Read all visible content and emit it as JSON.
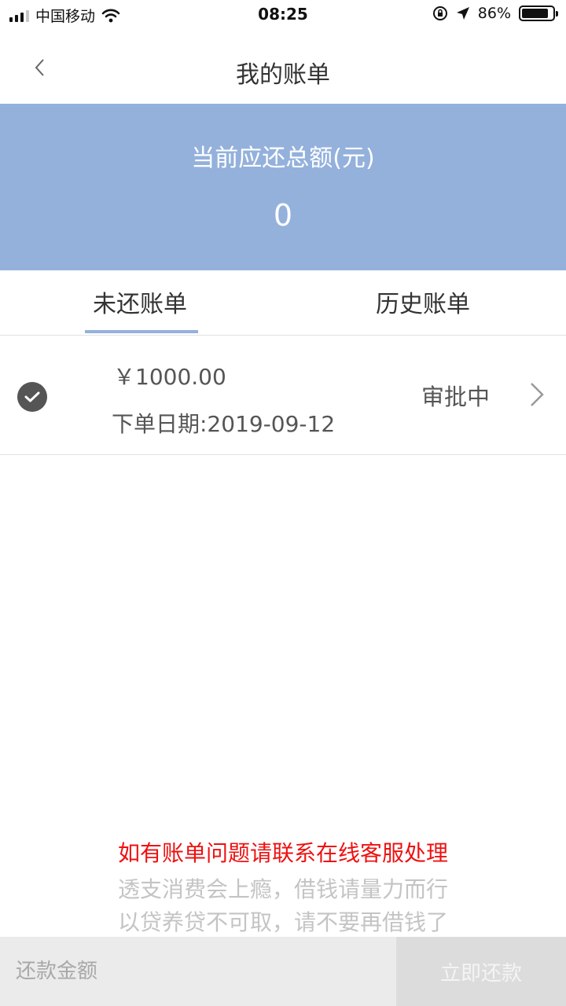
{
  "status_bar": {
    "carrier": "中国移动",
    "time": "08:25",
    "battery": "86%",
    "battery_level": 0.86,
    "icons": [
      "signal-icon",
      "wifi-icon",
      "rotation-lock-icon",
      "location-arrow-icon",
      "battery-icon"
    ]
  },
  "nav": {
    "title": "我的账单",
    "back_icon": "chevron-left-icon"
  },
  "summary": {
    "label": "当前应还总额(元)",
    "amount": "0"
  },
  "tabs": [
    {
      "label": "未还账单",
      "active": true
    },
    {
      "label": "历史账单",
      "active": false
    }
  ],
  "bills": [
    {
      "amount": "￥1000.00",
      "date": "下单日期:2019-09-12",
      "status": "审批中",
      "icon": "check-circle-icon"
    }
  ],
  "notices": {
    "warning": "如有账单问题请联系在线客服处理",
    "line1": "透支消费会上瘾，借钱请量力而行",
    "line2": "以贷养贷不可取，请不要再借钱了"
  },
  "bottom": {
    "placeholder": "还款金额",
    "value": "",
    "button": "立即还款"
  },
  "colors": {
    "banner": "#94b1dc",
    "warning": "#ee1111",
    "muted": "#c4c4c4"
  }
}
